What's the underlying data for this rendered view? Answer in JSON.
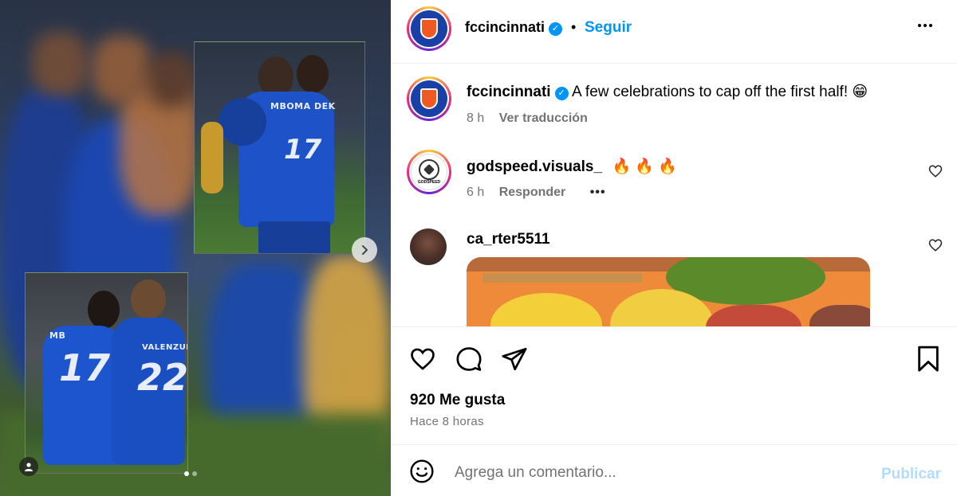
{
  "post": {
    "account": "fccincinnati",
    "follow_label": "Seguir",
    "more_icon": "more-horizontal-icon",
    "separator": "•"
  },
  "media": {
    "jersey_top_name": "MBOMA DEK",
    "jersey_top_number": "17",
    "jersey_bottom_left_name": "MB",
    "jersey_bottom_left_number": "17",
    "jersey_bottom_right_name": "VALENZUELA",
    "jersey_bottom_right_number": "22",
    "carousel_dots": 2,
    "active_dot": 0
  },
  "caption": {
    "user": "fccincinnati",
    "text": "A few celebrations to cap off the first half! 😁",
    "age": "8 h",
    "translate_label": "Ver traducción"
  },
  "comments": [
    {
      "user": "godspeed.visuals_",
      "text": "🔥 🔥 🔥",
      "age": "6 h",
      "reply_label": "Responder",
      "more": "•••",
      "avatar_text": "GODSPEED"
    },
    {
      "user": "ca_rter5511",
      "text": "",
      "age": "",
      "reply_label": ""
    }
  ],
  "actions": {
    "likes": "920 Me gusta",
    "posted": "Hace 8 horas"
  },
  "composer": {
    "placeholder": "Agrega un comentario...",
    "publish_label": "Publicar"
  },
  "colors": {
    "link_blue": "#0095f6",
    "publish_disabled": "#b3dbff",
    "muted": "#737373"
  }
}
